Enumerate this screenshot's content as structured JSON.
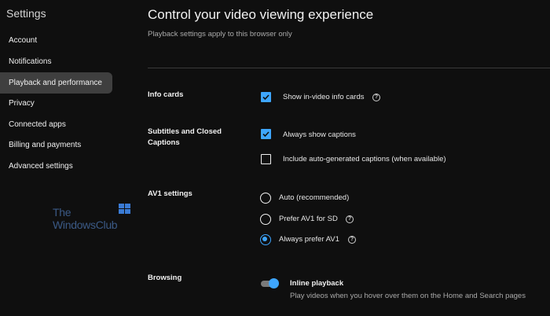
{
  "sidebar": {
    "title": "Settings",
    "items": [
      {
        "label": "Account"
      },
      {
        "label": "Notifications"
      },
      {
        "label": "Playback and performance"
      },
      {
        "label": "Privacy"
      },
      {
        "label": "Connected apps"
      },
      {
        "label": "Billing and payments"
      },
      {
        "label": "Advanced settings"
      }
    ],
    "active_index": 2
  },
  "watermark": {
    "line1": "The",
    "line2": "WindowsClub"
  },
  "main": {
    "title": "Control your video viewing experience",
    "subtitle": "Playback settings apply to this browser only"
  },
  "sections": {
    "info_cards": {
      "label": "Info cards",
      "option": {
        "label": "Show in-video info cards",
        "checked": true,
        "help_icon": "question-circle"
      }
    },
    "captions": {
      "label": "Subtitles and Closed Captions",
      "options": [
        {
          "label": "Always show captions",
          "checked": true
        },
        {
          "label": "Include auto-generated captions (when available)",
          "checked": false
        }
      ]
    },
    "av1": {
      "label": "AV1 settings",
      "options": [
        {
          "label": "Auto (recommended)",
          "selected": false
        },
        {
          "label": "Prefer AV1 for SD",
          "selected": false,
          "help_icon": "question-circle"
        },
        {
          "label": "Always prefer AV1",
          "selected": true,
          "help_icon": "question-circle"
        }
      ]
    },
    "browsing": {
      "label": "Browsing",
      "toggle": {
        "title": "Inline playback",
        "description": "Play videos when you hover over them on the Home and Search pages",
        "on": true
      }
    }
  },
  "colors": {
    "accent": "#3ea6ff",
    "background": "#0f0f0f",
    "active_nav": "#3f3f3f"
  }
}
